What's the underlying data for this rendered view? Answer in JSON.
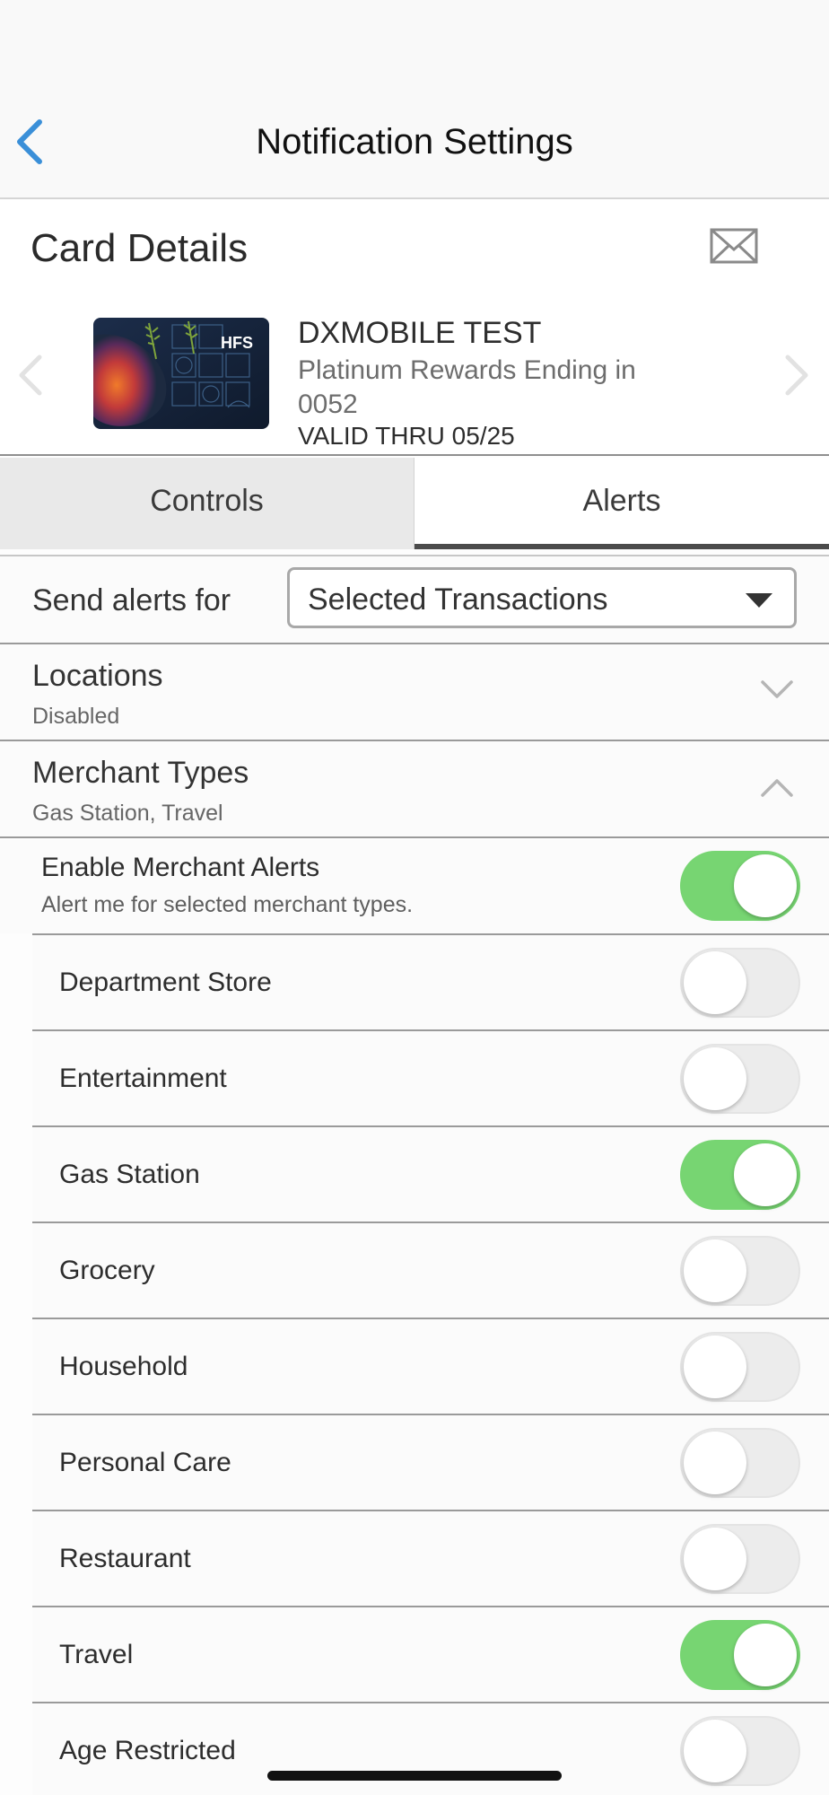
{
  "nav": {
    "title": "Notification Settings",
    "back_icon": "chevron-left-icon"
  },
  "card_details": {
    "title": "Card Details",
    "mail_icon": "mail-icon"
  },
  "card": {
    "name": "DXMOBILE TEST",
    "description": "Platinum Rewards Ending in 0052",
    "valid_thru": "VALID THRU 05/25",
    "logo_text": "HFS"
  },
  "tabs": [
    {
      "label": "Controls",
      "selected": false
    },
    {
      "label": "Alerts",
      "selected": true
    }
  ],
  "send_alerts": {
    "label": "Send alerts for",
    "value": "Selected Transactions"
  },
  "sections": {
    "locations": {
      "title": "Locations",
      "subtitle": "Disabled",
      "expanded": false
    },
    "merchant_types": {
      "title": "Merchant Types",
      "subtitle": "Gas Station, Travel",
      "expanded": true
    }
  },
  "merchant_alerts": {
    "title": "Enable Merchant Alerts",
    "subtitle": "Alert me for selected merchant types.",
    "enabled": true
  },
  "merchant_items": [
    {
      "label": "Department Store",
      "enabled": false
    },
    {
      "label": "Entertainment",
      "enabled": false
    },
    {
      "label": "Gas Station",
      "enabled": true
    },
    {
      "label": "Grocery",
      "enabled": false
    },
    {
      "label": "Household",
      "enabled": false
    },
    {
      "label": "Personal Care",
      "enabled": false
    },
    {
      "label": "Restaurant",
      "enabled": false
    },
    {
      "label": "Travel",
      "enabled": true
    },
    {
      "label": "Age Restricted",
      "enabled": false
    }
  ],
  "colors": {
    "accent": "#3a8fd8",
    "toggle_on": "#77d572",
    "toggle_off": "#ececec"
  }
}
